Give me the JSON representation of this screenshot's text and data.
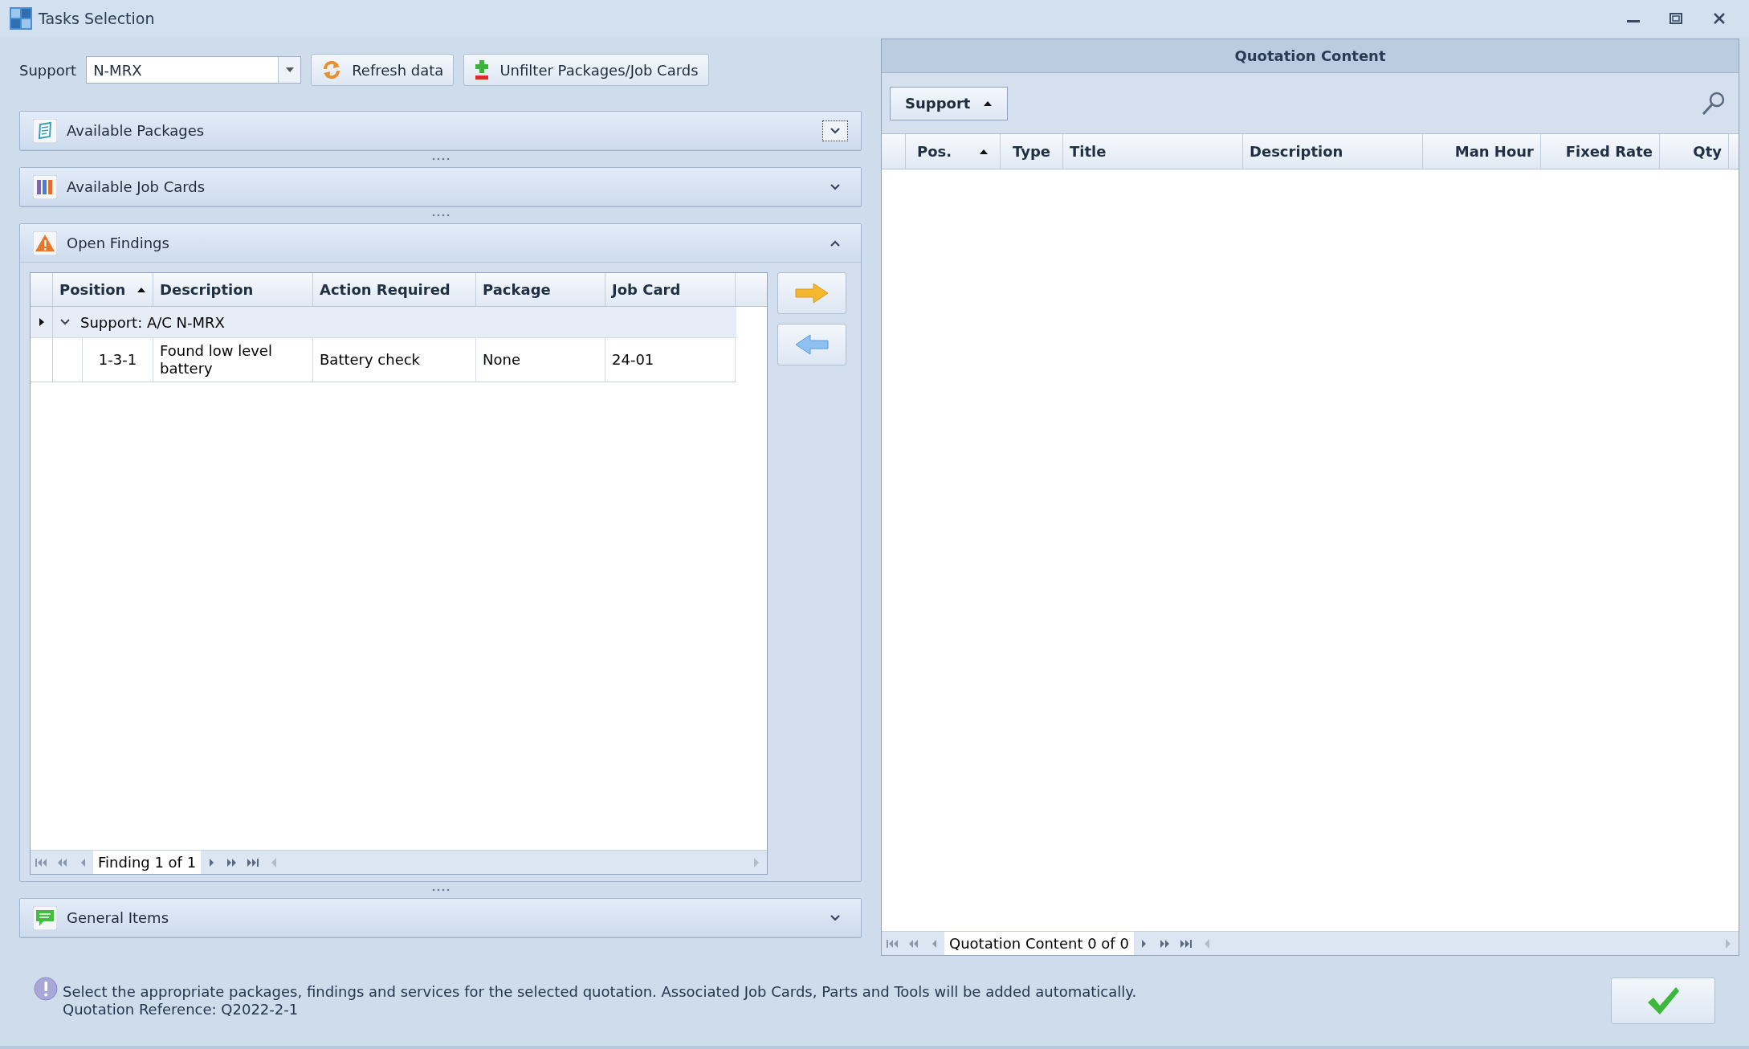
{
  "window": {
    "title": "Tasks Selection"
  },
  "toolbar": {
    "support_label": "Support",
    "support_value": "N-MRX",
    "buttons": [
      {
        "kind": "refresh",
        "label": "Refresh data"
      },
      {
        "kind": "unfilter",
        "label": "Unfilter Packages/Job Cards"
      }
    ]
  },
  "sections": [
    {
      "kind": "packages",
      "title": "Available Packages",
      "expanded": false,
      "focused": true
    },
    {
      "kind": "jobcards",
      "title": "Available Job Cards",
      "expanded": false,
      "focused": false
    },
    {
      "kind": "findings",
      "title": "Open Findings",
      "expanded": true,
      "focused": false
    },
    {
      "kind": "general",
      "title": "General Items",
      "expanded": false,
      "focused": false
    }
  ],
  "findings": {
    "columns": [
      {
        "label": "Position",
        "sorted": true
      },
      {
        "label": "Description",
        "sorted": false
      },
      {
        "label": "Action Required",
        "sorted": false
      },
      {
        "label": "Package",
        "sorted": false
      },
      {
        "label": "Job Card",
        "sorted": false
      }
    ],
    "groups": [
      {
        "label": "Support: A/C N-MRX",
        "expanded": true,
        "current": true,
        "rows": [
          {
            "cells": [
              "1-3-1",
              "Found low level battery",
              "Battery check",
              "None",
              "24-01"
            ]
          }
        ]
      }
    ],
    "pager": "Finding 1 of 1"
  },
  "quotation": {
    "title": "Quotation Content",
    "group_button": "Support",
    "columns": [
      {
        "label": "Pos.",
        "sorted": true
      },
      {
        "label": "Type",
        "sorted": false
      },
      {
        "label": "Title",
        "sorted": false
      },
      {
        "label": "Description",
        "sorted": false
      },
      {
        "label": "Man Hour",
        "sorted": false
      },
      {
        "label": "Fixed Rate",
        "sorted": false
      },
      {
        "label": "Qty",
        "sorted": false
      }
    ],
    "pager": "Quotation Content 0 of 0"
  },
  "footer": {
    "message": "Select the appropriate packages, findings and services for the selected quotation. Associated Job Cards, Parts and Tools will be added automatically.",
    "reference": "Quotation Reference: Q2022-2-1"
  }
}
